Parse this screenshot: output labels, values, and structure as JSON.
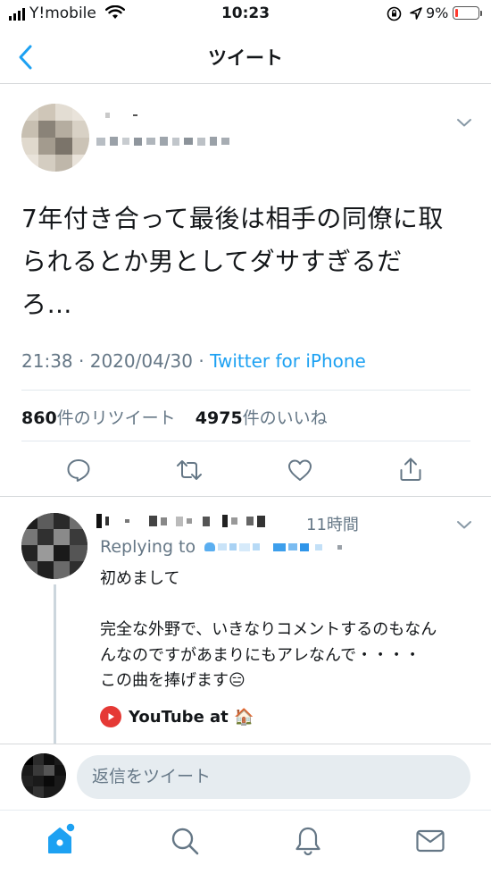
{
  "status_bar": {
    "carrier": "Y!mobile",
    "time": "10:23",
    "battery_percent": "9%",
    "battery_level": 0.09
  },
  "header": {
    "title": "ツイート"
  },
  "tweet": {
    "text_lines": [
      "7年付き合って最後は相手の同僚に取",
      "られるとか男としてダサすぎるだ",
      "ろ…"
    ],
    "time": "21:38",
    "separator": "·",
    "date": "2020/04/30",
    "source": "Twitter for iPhone",
    "retweet_count": "860",
    "retweet_label": "件のリツイート",
    "like_count": "4975",
    "like_label": "件のいいね"
  },
  "actions": [
    {
      "icon": "reply-icon"
    },
    {
      "icon": "retweet-icon"
    },
    {
      "icon": "like-icon"
    },
    {
      "icon": "share-icon"
    }
  ],
  "reply": {
    "time": "11時間",
    "replying_to_label": "Replying to",
    "lines": [
      "初めまして",
      "",
      "完全な外野で、いきなりコメントするのもなん",
      "んなのですがあまりにもアレなんで・・・・",
      "この曲を捧げます😑"
    ],
    "link_text": "YouTube at 🏠"
  },
  "compose": {
    "placeholder": "返信をツイート"
  },
  "tabbar": [
    {
      "icon": "home-icon",
      "active": true
    },
    {
      "icon": "search-icon",
      "active": false
    },
    {
      "icon": "notifications-icon",
      "active": false
    },
    {
      "icon": "messages-icon",
      "active": false
    }
  ],
  "colors": {
    "accent": "#1da1f2",
    "secondary_text": "#657786",
    "divider": "#e1e8ed",
    "battery_low": "#ff3b30",
    "youtube_red": "#e53935"
  }
}
